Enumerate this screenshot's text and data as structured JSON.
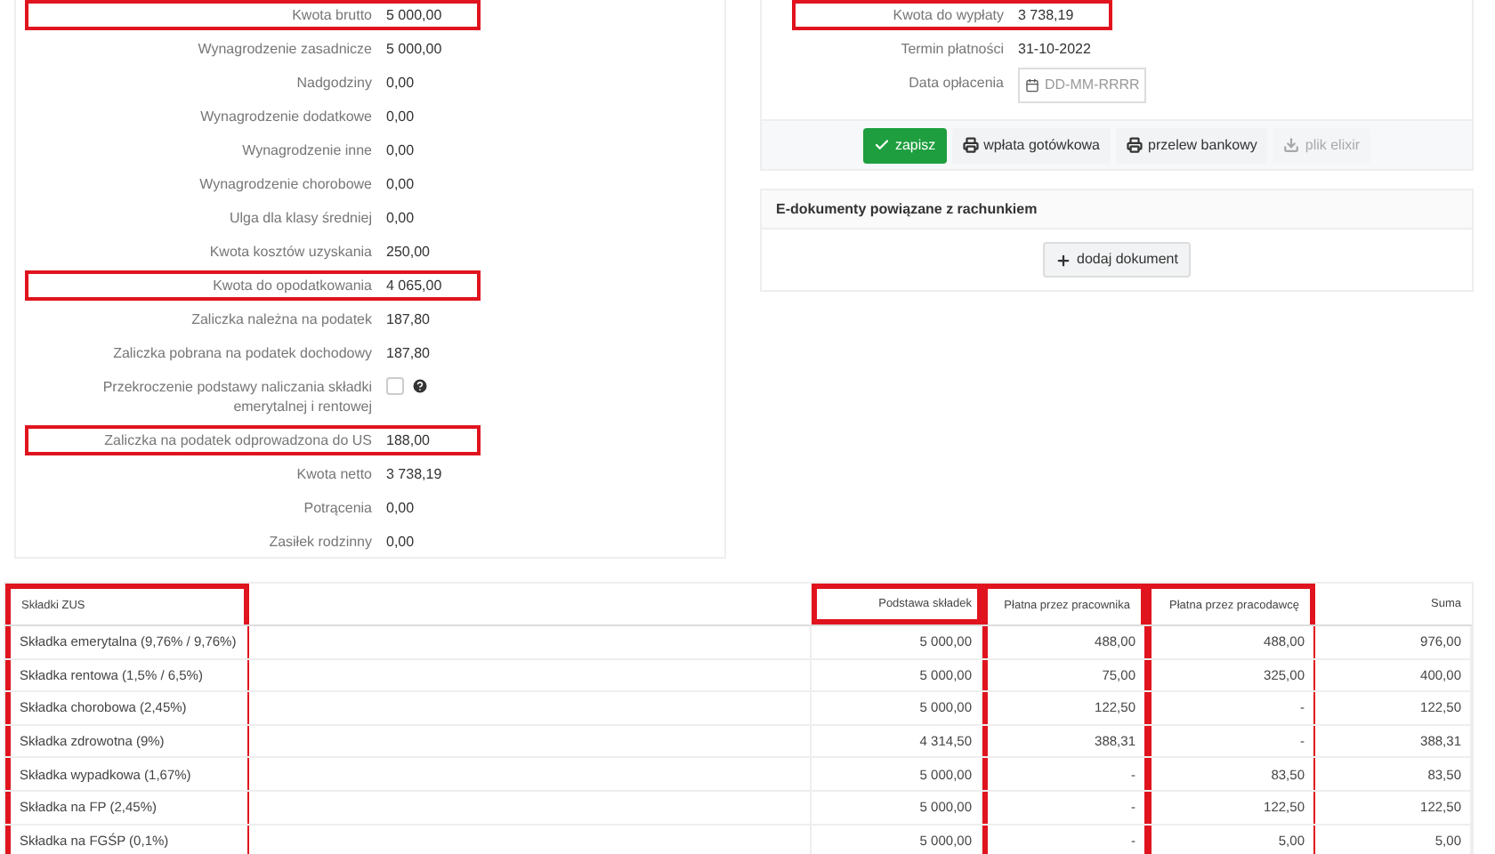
{
  "salary_rows": [
    {
      "kind": "value",
      "label": "Kwota brutto",
      "value": "5 000,00",
      "highlighted": true
    },
    {
      "kind": "value",
      "label": "Wynagrodzenie zasadnicze",
      "value": "5 000,00",
      "highlighted": false
    },
    {
      "kind": "value",
      "label": "Nadgodziny",
      "value": "0,00",
      "highlighted": false
    },
    {
      "kind": "value",
      "label": "Wynagrodzenie dodatkowe",
      "value": "0,00",
      "highlighted": false
    },
    {
      "kind": "value",
      "label": "Wynagrodzenie inne",
      "value": "0,00",
      "highlighted": false
    },
    {
      "kind": "value",
      "label": "Wynagrodzenie chorobowe",
      "value": "0,00",
      "highlighted": false
    },
    {
      "kind": "value",
      "label": "Ulga dla klasy średniej",
      "value": "0,00",
      "highlighted": false
    },
    {
      "kind": "value",
      "label": "Kwota kosztów uzyskania",
      "value": "250,00",
      "highlighted": false
    },
    {
      "kind": "value",
      "label": "Kwota do opodatkowania",
      "value": "4 065,00",
      "highlighted": true
    },
    {
      "kind": "value",
      "label": "Zaliczka należna na podatek",
      "value": "187,80",
      "highlighted": false
    },
    {
      "kind": "value",
      "label": "Zaliczka pobrana na podatek dochodowy",
      "value": "187,80",
      "highlighted": false
    },
    {
      "kind": "checkbox",
      "label": "Przekroczenie podstawy naliczania składki emerytalnej i rentowej",
      "checked": false,
      "highlighted": false
    },
    {
      "kind": "value",
      "label": "Zaliczka na podatek odprowadzona do US",
      "value": "188,00",
      "highlighted": true
    },
    {
      "kind": "value",
      "label": "Kwota netto",
      "value": "3 738,19",
      "highlighted": false
    },
    {
      "kind": "value",
      "label": "Potrącenia",
      "value": "0,00",
      "highlighted": false
    },
    {
      "kind": "value",
      "label": "Zasiłek rodzinny",
      "value": "0,00",
      "highlighted": false
    }
  ],
  "payment": {
    "rows": [
      {
        "kind": "value",
        "label": "Kwota do wypłaty",
        "value": "3 738,19",
        "highlighted": true
      },
      {
        "kind": "value",
        "label": "Termin płatności",
        "value": "31-10-2022",
        "highlighted": false
      },
      {
        "kind": "date",
        "label": "Data opłacenia",
        "placeholder": "DD-MM-RRRR",
        "highlighted": false
      }
    ],
    "buttons": [
      {
        "kind": "save",
        "label": "zapisz",
        "disabled": false
      },
      {
        "kind": "print",
        "label": "wpłata gotówkowa",
        "disabled": false
      },
      {
        "kind": "print",
        "label": "przelew bankowy",
        "disabled": false
      },
      {
        "kind": "download",
        "label": "plik elixir",
        "disabled": true
      }
    ]
  },
  "edocuments": {
    "title": "E-dokumenty powiązane z rachunkiem",
    "add_button": "dodaj dokument"
  },
  "zus_table": {
    "columns": [
      {
        "label": "Składki ZUS",
        "highlighted": true,
        "header_highlighted": false
      },
      {
        "label": "Podstawa składek",
        "highlighted": false,
        "header_highlighted": true
      },
      {
        "label": "Płatna przez pracownika",
        "highlighted": true,
        "header_highlighted": false
      },
      {
        "label": "Płatna przez pracodawcę",
        "highlighted": true,
        "header_highlighted": false
      },
      {
        "label": "Suma",
        "highlighted": false,
        "header_highlighted": false
      }
    ],
    "rows": [
      [
        "Składka emerytalna (9,76% / 9,76%)",
        "5 000,00",
        "488,00",
        "488,00",
        "976,00"
      ],
      [
        "Składka rentowa (1,5% / 6,5%)",
        "5 000,00",
        "75,00",
        "325,00",
        "400,00"
      ],
      [
        "Składka chorobowa (2,45%)",
        "5 000,00",
        "122,50",
        "-",
        "122,50"
      ],
      [
        "Składka zdrowotna (9%)",
        "4 314,50",
        "388,31",
        "-",
        "388,31"
      ],
      [
        "Składka wypadkowa (1,67%)",
        "5 000,00",
        "-",
        "83,50",
        "83,50"
      ],
      [
        "Składka na FP (2,45%)",
        "5 000,00",
        "-",
        "122,50",
        "122,50"
      ],
      [
        "Składka na FGŚP (0,1%)",
        "5 000,00",
        "-",
        "5,00",
        "5,00"
      ]
    ]
  }
}
